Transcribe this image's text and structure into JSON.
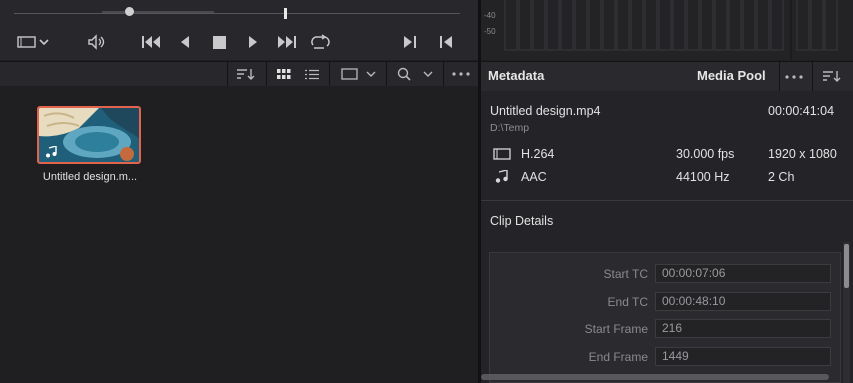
{
  "viewer": {
    "buttons": [
      "clip-display",
      "volume",
      "jump-start",
      "prev-frame",
      "stop",
      "play",
      "jump-end",
      "loop",
      "mark-in-out-next",
      "mark-out"
    ]
  },
  "meters": {
    "labels": [
      "-40",
      "-50"
    ]
  },
  "clip": {
    "name": "Untitled design.m..."
  },
  "metadata": {
    "title": "Metadata",
    "media_pool_tab": "Media Pool",
    "file_name": "Untitled design.mp4",
    "duration": "00:00:41:04",
    "path": "D:\\Temp",
    "video_codec": "H.264",
    "fps": "30.000 fps",
    "resolution": "1920 x 1080",
    "audio_codec": "AAC",
    "sample_rate": "44100 Hz",
    "channels": "2 Ch",
    "clip_details_title": "Clip Details",
    "details": [
      {
        "label": "Start TC",
        "value": "00:00:07:06"
      },
      {
        "label": "End TC",
        "value": "00:00:48:10"
      },
      {
        "label": "Start Frame",
        "value": "216"
      },
      {
        "label": "End Frame",
        "value": "1449"
      }
    ]
  },
  "colors": {
    "accent": "#e2644c",
    "panel": "#28282c"
  }
}
